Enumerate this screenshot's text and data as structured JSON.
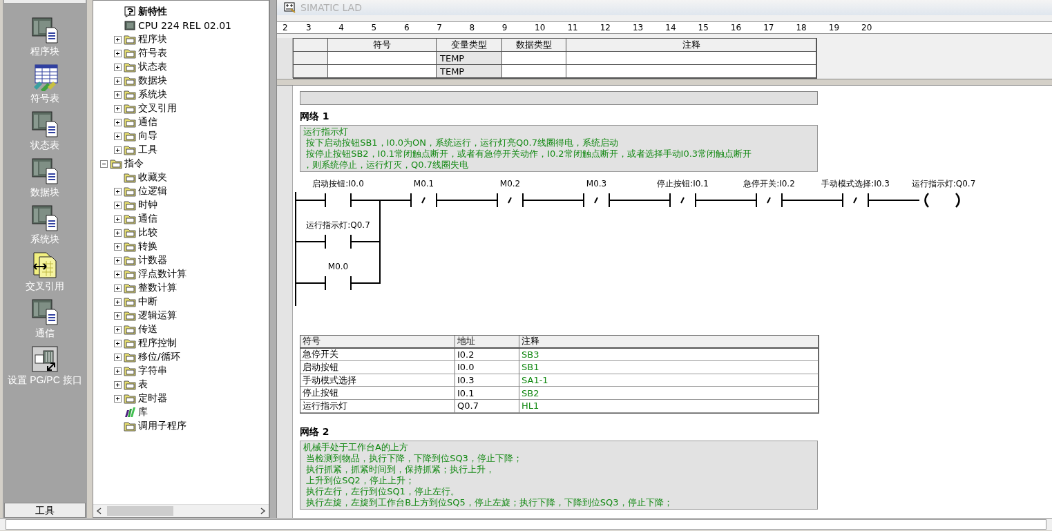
{
  "nav_bar": {
    "items": [
      {
        "label": "程序块",
        "kind": "plc"
      },
      {
        "label": "符号表",
        "kind": "table"
      },
      {
        "label": "状态表",
        "kind": "plc"
      },
      {
        "label": "数据块",
        "kind": "plc"
      },
      {
        "label": "系统块",
        "kind": "plc"
      },
      {
        "label": "交叉引用",
        "kind": "crossref"
      },
      {
        "label": "通信",
        "kind": "plc"
      },
      {
        "label": "设置 PG/PC 接口",
        "kind": "pgpc"
      }
    ],
    "footer_button": "工具"
  },
  "tree": {
    "items": [
      {
        "label": "新特性",
        "kind": "help",
        "bold": true
      },
      {
        "label": "CPU 224 REL 02.01",
        "kind": "cpu"
      },
      {
        "label": "程序块",
        "kind": "folder",
        "expanded": false
      },
      {
        "label": "符号表",
        "kind": "folder",
        "expanded": false
      },
      {
        "label": "状态表",
        "kind": "folder",
        "expanded": false
      },
      {
        "label": "数据块",
        "kind": "folder",
        "expanded": false
      },
      {
        "label": "系统块",
        "kind": "folder",
        "expanded": false
      },
      {
        "label": "交叉引用",
        "kind": "folder",
        "expanded": false
      },
      {
        "label": "通信",
        "kind": "folder",
        "expanded": false
      },
      {
        "label": "向导",
        "kind": "folder",
        "expanded": false
      },
      {
        "label": "工具",
        "kind": "folder",
        "expanded": false
      },
      {
        "label": "指令",
        "kind": "folder",
        "expanded": true,
        "children": [
          {
            "label": "收藏夹",
            "kind": "folder"
          },
          {
            "label": "位逻辑",
            "kind": "folder",
            "expanded": false
          },
          {
            "label": "时钟",
            "kind": "folder",
            "expanded": false
          },
          {
            "label": "通信",
            "kind": "folder",
            "expanded": false
          },
          {
            "label": "比较",
            "kind": "folder",
            "expanded": false
          },
          {
            "label": "转换",
            "kind": "folder",
            "expanded": false
          },
          {
            "label": "计数器",
            "kind": "folder",
            "expanded": false
          },
          {
            "label": "浮点数计算",
            "kind": "folder",
            "expanded": false
          },
          {
            "label": "整数计算",
            "kind": "folder",
            "expanded": false
          },
          {
            "label": "中断",
            "kind": "folder",
            "expanded": false
          },
          {
            "label": "逻辑运算",
            "kind": "folder",
            "expanded": false
          },
          {
            "label": "传送",
            "kind": "folder",
            "expanded": false
          },
          {
            "label": "程序控制",
            "kind": "folder",
            "expanded": false
          },
          {
            "label": "移位/循环",
            "kind": "folder",
            "expanded": false
          },
          {
            "label": "字符串",
            "kind": "folder",
            "expanded": false
          },
          {
            "label": "表",
            "kind": "folder",
            "expanded": false
          },
          {
            "label": "定时器",
            "kind": "folder",
            "expanded": false
          },
          {
            "label": "库",
            "kind": "library"
          },
          {
            "label": "调用子程序",
            "kind": "folder"
          }
        ]
      }
    ]
  },
  "editor": {
    "title": "SIMATIC LAD",
    "ruler": [
      "2",
      "3",
      "4",
      "5",
      "6",
      "7",
      "8",
      "9",
      "10",
      "11",
      "12",
      "13",
      "14",
      "15",
      "16",
      "17",
      "18",
      "19",
      "20"
    ],
    "var_table": {
      "columns": [
        "符号",
        "变量类型",
        "数据类型",
        "注释"
      ],
      "rows": [
        {
          "var_type": "TEMP"
        },
        {
          "var_type": "TEMP"
        }
      ]
    },
    "networks": [
      {
        "title": "网络 1",
        "comment": [
          "运行指示灯",
          " 按下启动按钮SB1，I0.0为ON，系统运行，运行灯亮Q0.7线圈得电，系统启动",
          " 按停止按钮SB2，I0.1常闭触点断开，或者有急停开关动作，I0.2常闭触点断开，或者选择手动I0.3常闭触点断开",
          "，则系统停止，运行灯灭，Q0.7线圈失电"
        ],
        "ladder": {
          "series": [
            {
              "label": "启动按钮:I0.0",
              "kind": "no"
            },
            {
              "label": "M0.1",
              "kind": "nc"
            },
            {
              "label": "M0.2",
              "kind": "nc"
            },
            {
              "label": "M0.3",
              "kind": "nc"
            },
            {
              "label": "停止按钮:I0.1",
              "kind": "nc"
            },
            {
              "label": "急停开关:I0.2",
              "kind": "nc"
            },
            {
              "label": "手动模式选择:I0.3",
              "kind": "nc"
            }
          ],
          "parallel": [
            {
              "label": "运行指示灯:Q0.7",
              "kind": "no"
            },
            {
              "label": "M0.0",
              "kind": "no"
            }
          ],
          "coil": {
            "label": "运行指示灯:Q0.7"
          }
        },
        "symbols": {
          "columns": [
            "符号",
            "地址",
            "注释"
          ],
          "rows": [
            [
              "急停开关",
              "I0.2",
              "SB3"
            ],
            [
              "启动按钮",
              "I0.0",
              "SB1"
            ],
            [
              "手动模式选择",
              "I0.3",
              "SA1-1"
            ],
            [
              "停止按钮",
              "I0.1",
              "SB2"
            ],
            [
              "运行指示灯",
              "Q0.7",
              "HL1"
            ]
          ]
        }
      },
      {
        "title": "网络 2",
        "comment": [
          "机械手处于工作台A的上方",
          " 当检测到物品，执行下降，下降到位SQ3，停止下降；",
          " 执行抓紧，抓紧时间到，保持抓紧；执行上升，",
          " 上升到位SQ2，停止上升；",
          " 执行左行，左行到位SQ1，停止左行。",
          " 执行左旋，左旋到工作台B上方到位SQ5，停止左旋；执行下降，下降到位SQ3，停止下降；"
        ]
      }
    ]
  }
}
